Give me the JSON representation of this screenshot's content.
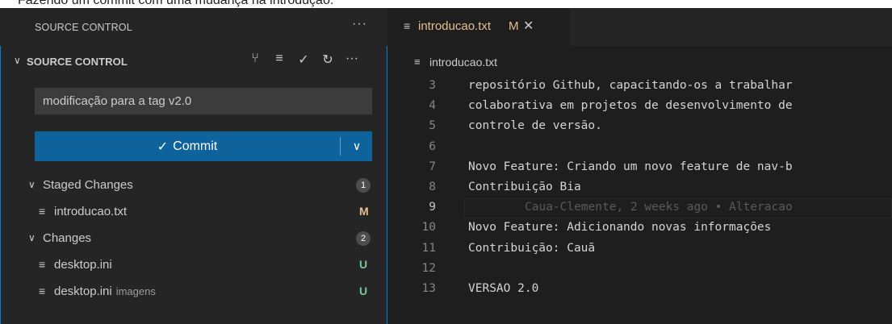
{
  "caption": "Fazendo um commit com uma mudança na introdução.",
  "sidebar": {
    "view_title": "SOURCE CONTROL",
    "view_more": "···",
    "panel": {
      "chevron": "∨",
      "title": "SOURCE CONTROL",
      "actions": [
        {
          "name": "graph-icon",
          "glyph": "⑂"
        },
        {
          "name": "view-as-tree-icon",
          "glyph": "≡"
        },
        {
          "name": "commit-check-icon",
          "glyph": "✓"
        },
        {
          "name": "refresh-icon",
          "glyph": "↻"
        },
        {
          "name": "more-actions-icon",
          "glyph": "···"
        }
      ]
    },
    "commit_message": "modificação para a tag v2.0",
    "commit_button": {
      "icon": "✓",
      "label": "Commit",
      "dropdown_icon": "∨"
    },
    "groups": [
      {
        "label": "Staged Changes",
        "count": "1",
        "files": [
          {
            "icon": "≡",
            "name": "introducao.txt",
            "dir": "",
            "status": "M"
          }
        ]
      },
      {
        "label": "Changes",
        "count": "2",
        "files": [
          {
            "icon": "≡",
            "name": "desktop.ini",
            "dir": "",
            "status": "U"
          },
          {
            "icon": "≡",
            "name": "desktop.ini",
            "dir": "imagens",
            "status": "U"
          }
        ]
      }
    ]
  },
  "editor": {
    "tab": {
      "icon": "≡",
      "name": "introducao.txt",
      "modified": "M",
      "close": "✕"
    },
    "breadcrumb": {
      "icon": "≡",
      "name": "introducao.txt"
    },
    "lines": [
      {
        "n": "3",
        "text": "repositório Github, capacitando-os a trabalhar"
      },
      {
        "n": "4",
        "text": "colaborativa em projetos de desenvolvimento de"
      },
      {
        "n": "5",
        "text": "controle de versão."
      },
      {
        "n": "6",
        "text": ""
      },
      {
        "n": "7",
        "text": "Novo Feature: Criando um novo feature de nav-b"
      },
      {
        "n": "8",
        "text": "Contribuição Bia"
      },
      {
        "n": "9",
        "text": "",
        "blame": "Caua-Clemente, 2 weeks ago • Alteracao ",
        "current": true
      },
      {
        "n": "10",
        "text": "Novo Feature: Adicionando novas informações"
      },
      {
        "n": "11",
        "text": "Contribuição: Cauã"
      },
      {
        "n": "12",
        "text": ""
      },
      {
        "n": "13",
        "text": "VERSAO 2.0"
      }
    ]
  },
  "colors": {
    "accent": "#0e639c",
    "focus_border": "#007fd4",
    "modified": "#e2c08d",
    "untracked": "#73c991"
  }
}
